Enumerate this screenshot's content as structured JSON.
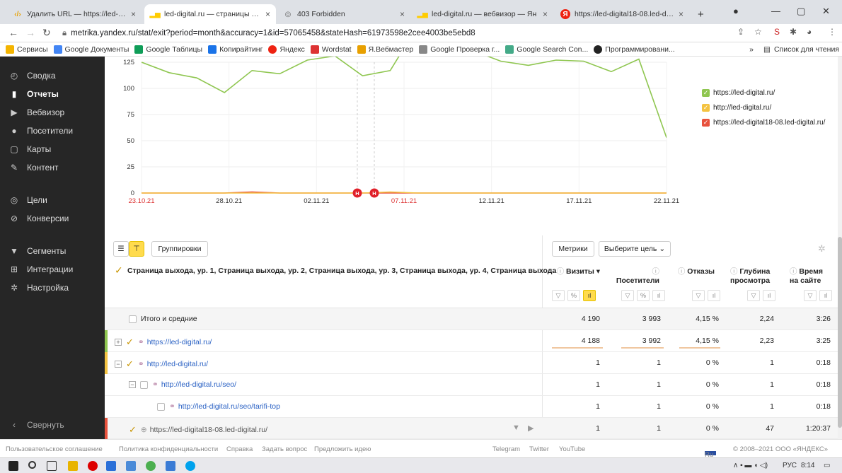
{
  "tabs": [
    {
      "title": "Удалить URL — https://led-digit",
      "active": false
    },
    {
      "title": "led-digital.ru — страницы выхо,",
      "active": true
    },
    {
      "title": "403 Forbidden",
      "active": false
    },
    {
      "title": "led-digital.ru — вебвизор — Ян",
      "active": false
    },
    {
      "title": "https://led-digital18-08.led-digit",
      "active": false
    }
  ],
  "address": {
    "url": "metrika.yandex.ru/stat/exit?period=month&accuracy=1&id=57065458&stateHash=61973598e2cee4003be5ebd8"
  },
  "bookmarks": [
    "Сервисы",
    "Google Документы",
    "Google Таблицы",
    "Копирайтинг",
    "Яндекс",
    "Wordstat",
    "Я.Вебмастер",
    "Google Проверка г...",
    "Google Search Con...",
    "Программировани..."
  ],
  "bookmarks_right": "Список для чтения",
  "bookmarks_more": "»",
  "sidebar": {
    "items": [
      {
        "label": "Сводка",
        "icon": "gauge-icon"
      },
      {
        "label": "Отчеты",
        "icon": "bar-chart-icon",
        "active": true
      },
      {
        "label": "Вебвизор",
        "icon": "play-icon"
      },
      {
        "label": "Посетители",
        "icon": "user-icon"
      },
      {
        "label": "Карты",
        "icon": "map-icon"
      },
      {
        "label": "Контент",
        "icon": "pen-icon"
      }
    ],
    "items2": [
      {
        "label": "Цели",
        "icon": "target-icon"
      },
      {
        "label": "Конверсии",
        "icon": "percent-icon"
      }
    ],
    "items3": [
      {
        "label": "Сегменты",
        "icon": "filter-icon"
      },
      {
        "label": "Интеграции",
        "icon": "plug-icon"
      },
      {
        "label": "Настройка",
        "icon": "gear-icon"
      }
    ],
    "collapse": "Свернуть"
  },
  "chart_data": {
    "type": "line",
    "y_ticks": [
      "125",
      "100",
      "75",
      "50",
      "25",
      "0"
    ],
    "ylim": [
      0,
      125
    ],
    "x_ticks": [
      "23.10.21",
      "28.10.21",
      "02.11.21",
      "07.11.21",
      "12.11.21",
      "17.11.21",
      "22.11.21"
    ],
    "annotation_markers": [
      "Н",
      "Н"
    ],
    "series": [
      {
        "name": "https://led-digital.ru/",
        "color": "#8fc650",
        "values": [
          125,
          115,
          110,
          96,
          117,
          114,
          127,
          131,
          112,
          117,
          160,
          158,
          136,
          126,
          122,
          127,
          126,
          116,
          128,
          53
        ]
      },
      {
        "name": "http://led-digital.ru/",
        "color": "#f4c341",
        "values": [
          0,
          0,
          0,
          0,
          0,
          0,
          0,
          0,
          0,
          1,
          0,
          0,
          0,
          0,
          0,
          0,
          0,
          0,
          0,
          0
        ]
      },
      {
        "name": "https://led-digital18-08.led-digital.ru/",
        "color": "#e8523d",
        "values": [
          0,
          0,
          0,
          0,
          1,
          0,
          0,
          0,
          0,
          0,
          0,
          0,
          0,
          0,
          0,
          0,
          0,
          0,
          0,
          0
        ]
      }
    ]
  },
  "toolbar": {
    "group_label": "Группировки",
    "metrics_label": "Метрики",
    "goal_label": "Выберите цель"
  },
  "table": {
    "dimension_header": "Страница выхода, ур. 1, Страница выхода, ур. 2, Страница выхода, ур. 3, Страница выхода, ур. 4, Страница выхода",
    "columns": [
      "Визиты",
      "Посетители",
      "Отказы",
      "Глубина просмотра",
      "Время на сайте"
    ],
    "columns_split": [
      [
        "Визиты ▾",
        ""
      ],
      [
        "Посетители",
        ""
      ],
      [
        "Отказы",
        ""
      ],
      [
        "Глубина",
        "просмотра"
      ],
      [
        "Время",
        "на сайте"
      ]
    ],
    "total_label": "Итого и средние",
    "total": [
      "4 190",
      "3 993",
      "4,15 %",
      "2,24",
      "3:26"
    ],
    "rows": [
      {
        "name": "https://led-digital.ru/",
        "values": [
          "4 188",
          "3 992",
          "4,15 %",
          "2,23",
          "3:25"
        ],
        "accent": "#8fc650"
      },
      {
        "name": "http://led-digital.ru/",
        "values": [
          "1",
          "1",
          "0 %",
          "1",
          "0:18"
        ],
        "accent": "#f4c341"
      },
      {
        "name": "http://led-digital.ru/seo/",
        "values": [
          "1",
          "1",
          "0 %",
          "1",
          "0:18"
        ],
        "accent": ""
      },
      {
        "name": "http://led-digital.ru/seo/tarifi-top",
        "values": [
          "1",
          "1",
          "0 %",
          "1",
          "0:18"
        ],
        "accent": ""
      },
      {
        "name": "https://led-digital18-08.led-digital.ru/",
        "values": [
          "1",
          "1",
          "0 %",
          "47",
          "1:20:37"
        ],
        "accent": "#e8523d"
      }
    ]
  },
  "footer": {
    "links": [
      "Пользовательское соглашение",
      "Политика конфиденциальности",
      "Справка",
      "Задать вопрос",
      "Предложить идею"
    ],
    "social": [
      "Telegram",
      "Twitter",
      "YouTube"
    ],
    "lang": "Ru",
    "copyright": "© 2008–2021 ООО «ЯНДЕКС»"
  },
  "taskbar": {
    "lang": "РУС",
    "time": "8:14"
  }
}
